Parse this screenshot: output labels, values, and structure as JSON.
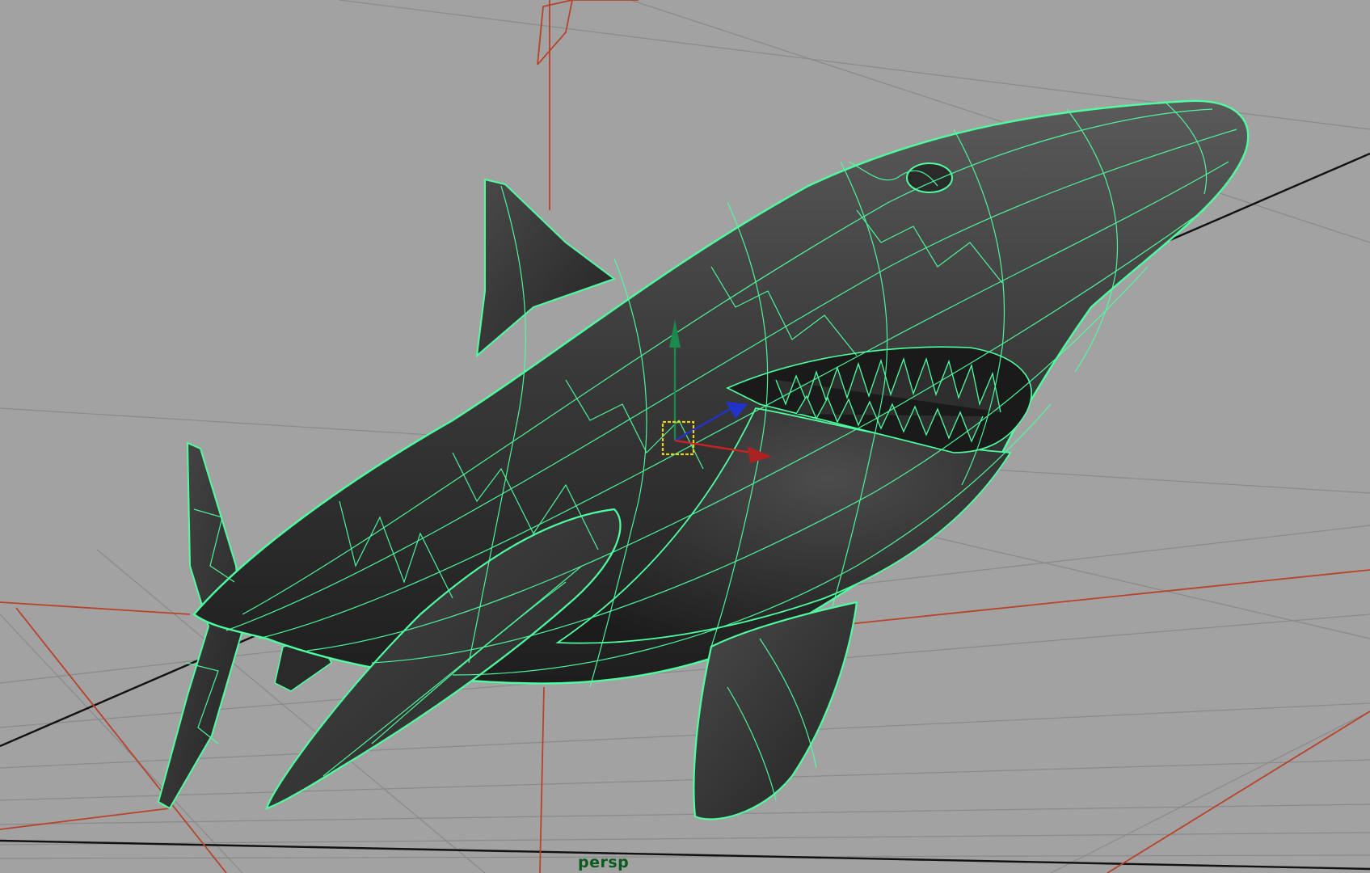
{
  "viewport": {
    "camera_label": "persp",
    "background": "#a2a2a2",
    "colors": {
      "grid": "#8a8a8a",
      "grid_axis": "#111111",
      "camera_lines": "#b8432a",
      "wireframe_highlight": "#4dff9f",
      "mesh_fill": "#3a3a3a",
      "manipulator_x": "#cc2222",
      "manipulator_y": "#1a8a4a",
      "manipulator_z": "#2233cc",
      "pivot": "#e8d21a"
    }
  },
  "scene": {
    "object": "shark-mesh",
    "selected": true,
    "tool": "move-manipulator"
  }
}
